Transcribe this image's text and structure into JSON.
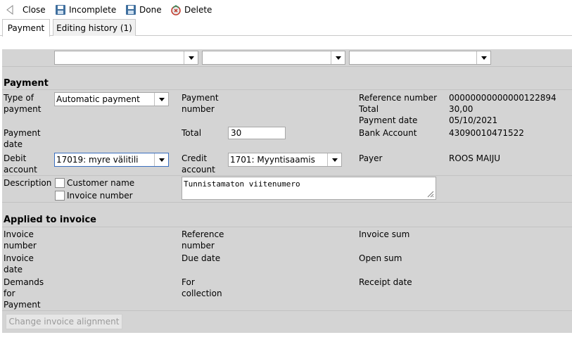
{
  "toolbar": {
    "close_label": "Close",
    "incomplete_label": "Incomplete",
    "done_label": "Done",
    "delete_label": "Delete"
  },
  "tabs": [
    {
      "label": "Payment"
    },
    {
      "label": "Editing history (1)"
    }
  ],
  "filters": [
    {
      "value": ""
    },
    {
      "value": ""
    },
    {
      "value": ""
    }
  ],
  "payment": {
    "title": "Payment",
    "type_of_payment_label": "Type of\npayment",
    "type_of_payment_value": "Automatic payment",
    "payment_number_label": "Payment\nnumber",
    "reference_number_label": "Reference number",
    "reference_number_value": "00000000000000122894",
    "total_right_label": "Total",
    "total_right_value": "30,00",
    "payment_date_right_label": "Payment date",
    "payment_date_right_value": "05/10/2021",
    "payment_date_label": "Payment\ndate",
    "total_label": "Total",
    "total_value": "30",
    "bank_account_label": "Bank Account",
    "bank_account_value": "43090010471522",
    "debit_account_label": "Debit\naccount",
    "debit_account_value": "17019: myre välitili",
    "credit_account_label": "Credit\naccount",
    "credit_account_value": "1701: Myyntisaamis",
    "payer_label": "Payer",
    "payer_value": "ROOS MAIJU",
    "description_label": "Description",
    "customer_name_label": "Customer name",
    "invoice_number_cb_label": "Invoice number",
    "description_text": "Tunnistamaton viitenumero"
  },
  "applied": {
    "title": "Applied to invoice",
    "invoice_number_label": "Invoice\nnumber",
    "reference_number_label": "Reference\nnumber",
    "invoice_sum_label": "Invoice sum",
    "invoice_date_label": "Invoice\ndate",
    "due_date_label": "Due date",
    "open_sum_label": "Open sum",
    "demands_label": "Demands\nfor\nPayment",
    "for_collection_label": "For\ncollection",
    "receipt_date_label": "Receipt date",
    "change_button_label": "Change invoice alignment"
  }
}
